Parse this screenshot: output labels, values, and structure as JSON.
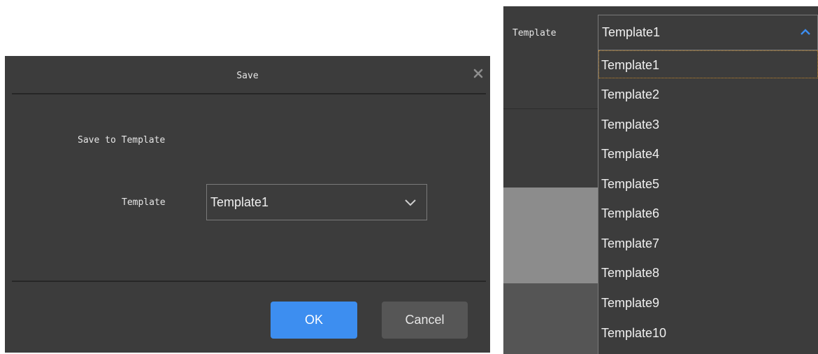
{
  "dialog": {
    "title": "Save",
    "section_label": "Save to Template",
    "template_label": "Template",
    "template_value": "Template1",
    "ok_label": "OK",
    "cancel_label": "Cancel"
  },
  "dropdown": {
    "template_label": "Template",
    "selected_value": "Template1",
    "options": [
      "Template1",
      "Template2",
      "Template3",
      "Template4",
      "Template5",
      "Template6",
      "Template7",
      "Template8",
      "Template9",
      "Template10"
    ]
  },
  "colors": {
    "dialog_bg": "#3c3c3c",
    "primary_button": "#3d8ef0",
    "secondary_button": "#565656",
    "chevron_up_accent": "#3d8ef0",
    "selected_outline": "#c98a2a"
  },
  "icons": [
    "close-icon",
    "chevron-down-icon",
    "chevron-up-icon"
  ]
}
